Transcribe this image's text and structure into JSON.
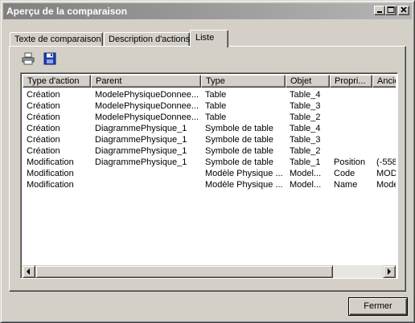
{
  "window": {
    "title": "Aperçu de la comparaison"
  },
  "tabs": [
    {
      "label": "Texte de comparaison",
      "selected": false
    },
    {
      "label": "Description d'actions",
      "selected": false
    },
    {
      "label": "Liste",
      "selected": true
    }
  ],
  "toolbar": {
    "print_icon": "print-icon",
    "save_icon": "floppy-save-icon"
  },
  "list": {
    "columns": [
      "Type d'action",
      "Parent",
      "Type",
      "Objet",
      "Propri...",
      "Ancie"
    ],
    "rows": [
      [
        "Création",
        "ModelePhysiqueDonnee...",
        "Table",
        "Table_4",
        "",
        ""
      ],
      [
        "Création",
        "ModelePhysiqueDonnee...",
        "Table",
        "Table_3",
        "",
        ""
      ],
      [
        "Création",
        "ModelePhysiqueDonnee...",
        "Table",
        "Table_2",
        "",
        ""
      ],
      [
        "Création",
        "DiagrammePhysique_1",
        "Symbole de table",
        "Table_4",
        "",
        ""
      ],
      [
        "Création",
        "DiagrammePhysique_1",
        "Symbole de table",
        "Table_3",
        "",
        ""
      ],
      [
        "Création",
        "DiagrammePhysique_1",
        "Symbole de table",
        "Table_2",
        "",
        ""
      ],
      [
        "Modification",
        "DiagrammePhysique_1",
        "Symbole de table",
        "Table_1",
        "Position",
        "(-558"
      ],
      [
        "Modification",
        "",
        "Modèle Physique ...",
        "Model...",
        "Code",
        "MOD"
      ],
      [
        "Modification",
        "",
        "Modèle Physique ...",
        "Model...",
        "Name",
        "Mode"
      ]
    ]
  },
  "footer": {
    "close_label": "Fermer"
  },
  "colors": {
    "titlebar_start": "#808080",
    "titlebar_end": "#b5b5b5",
    "face": "#d4d0c8"
  }
}
